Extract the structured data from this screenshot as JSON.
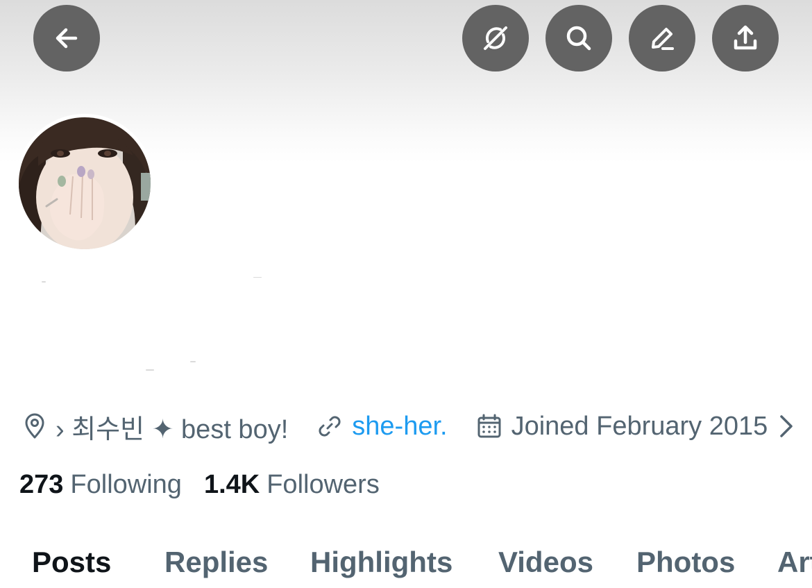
{
  "header": {
    "buttons": [
      {
        "name": "back-button",
        "icon": "arrow-left-icon"
      },
      {
        "name": "grok-button",
        "icon": "grok-icon"
      },
      {
        "name": "search-button",
        "icon": "search-icon"
      },
      {
        "name": "edit-button",
        "icon": "pencil-icon"
      },
      {
        "name": "share-button",
        "icon": "share-icon"
      }
    ],
    "button_color": "#636363"
  },
  "profile": {
    "avatar_icon": "profile-photo",
    "location": "› 최수빈 ✦ best boy!",
    "link": "she-her.",
    "joined": "Joined February 2015"
  },
  "stats": {
    "following_count": "273",
    "following_label": "Following",
    "followers_count": "1.4K",
    "followers_label": "Followers"
  },
  "tabs": [
    "Posts",
    "Replies",
    "Highlights",
    "Videos",
    "Photos",
    "Articles"
  ],
  "active_tab": "Posts",
  "colors": {
    "text_primary": "#0f1419",
    "text_secondary": "#536471",
    "link": "#1d9bf0"
  }
}
